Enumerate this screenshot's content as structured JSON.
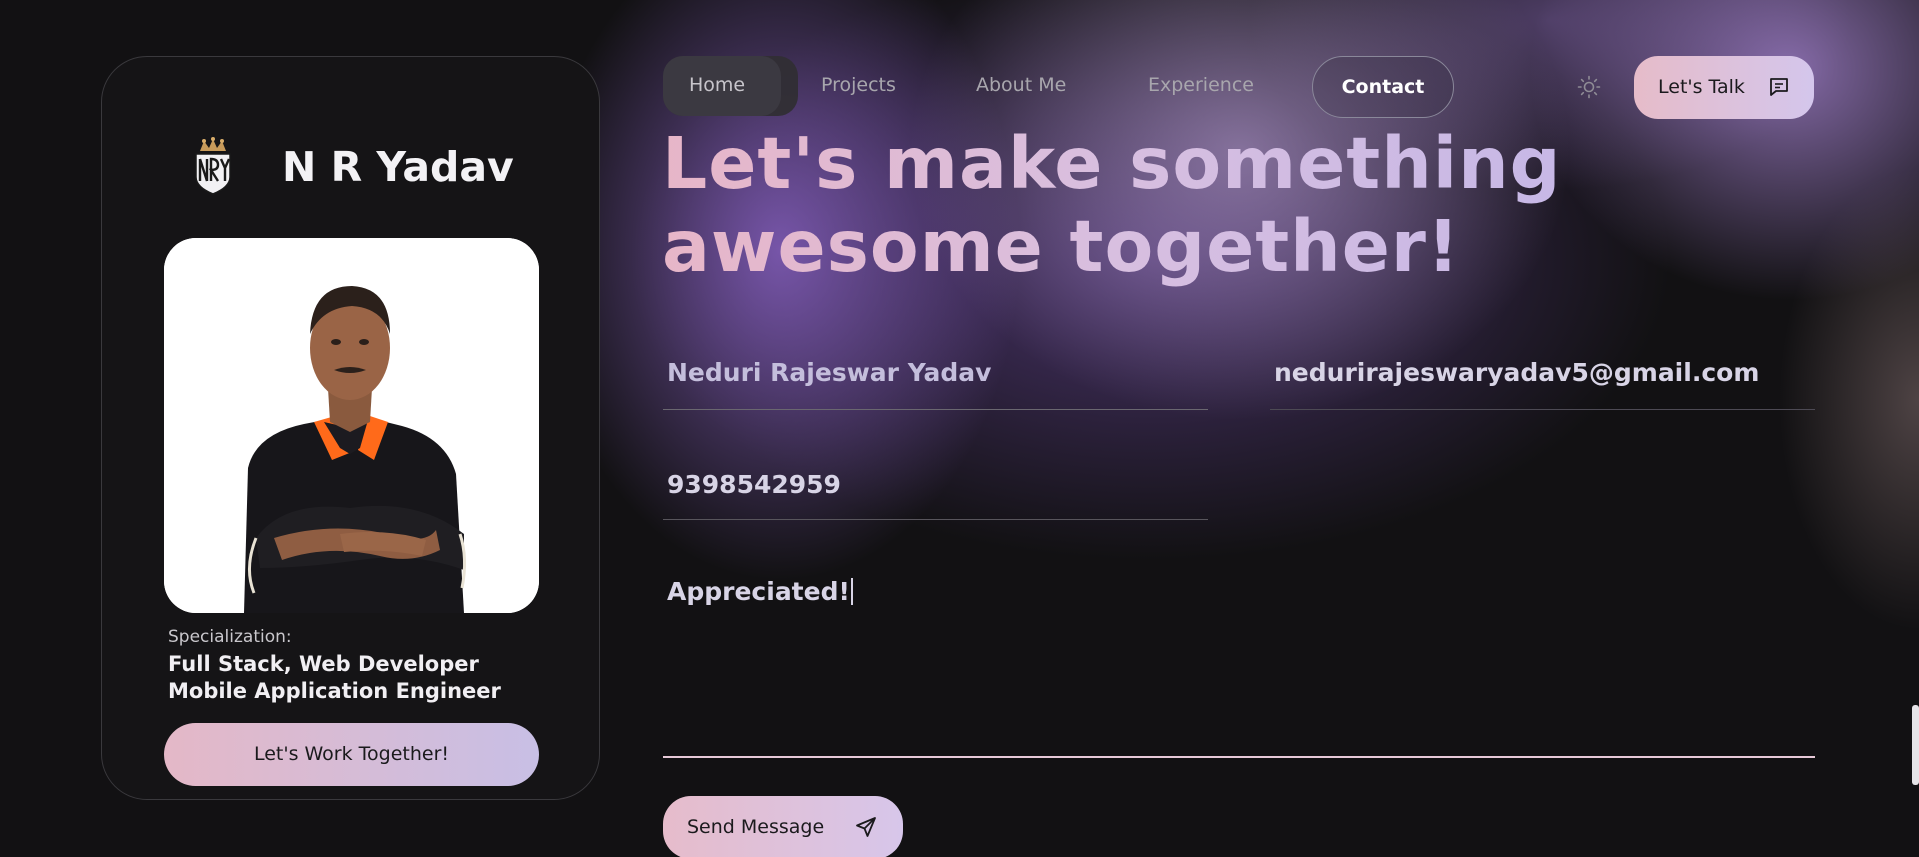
{
  "colors": {
    "background": "#121113",
    "accent_gradient_start": "#e4b8c7",
    "accent_gradient_end": "#c8bfe5"
  },
  "profile": {
    "logo_icon": "nry-crown-shield-icon",
    "name": "N R Yadav",
    "photo": "portrait-photo",
    "specialization_label": "Specialization:",
    "specialization_line1": "Full Stack, Web Developer",
    "specialization_line2": "Mobile Application Engineer",
    "cta_label": "Let's Work Together!"
  },
  "nav": {
    "items": [
      {
        "label": "Home",
        "active": true
      },
      {
        "label": "Projects"
      },
      {
        "label": "About Me"
      },
      {
        "label": "Experience"
      },
      {
        "label": "Contact",
        "selected": true
      }
    ],
    "theme_toggle_icon": "sun-icon",
    "talk_label": "Let's Talk",
    "talk_icon": "chat-bubble-icon"
  },
  "contact": {
    "headline_line1": "Let's make something",
    "headline_line2": "awesome together!",
    "name_value": "Neduri Rajeswar Yadav",
    "email_value": "nedurirajeswaryadav5@gmail.com",
    "phone_value": "9398542959",
    "message_value": "Appreciated!",
    "send_label": "Send Message",
    "send_icon": "paper-plane-icon"
  }
}
